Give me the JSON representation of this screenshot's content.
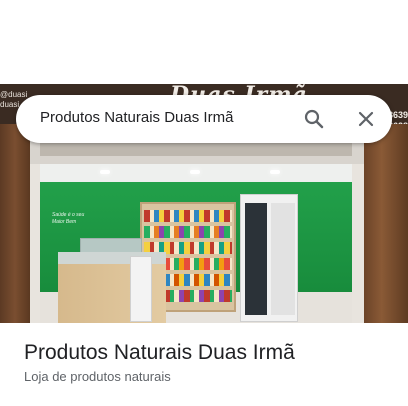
{
  "search": {
    "query": "Produtos Naturais Duas Irmã"
  },
  "photo": {
    "sign_text": "Duas Irmã",
    "left_handle_line1": "@duasi",
    "left_handle_line2": "duasi",
    "right_phone_line1": "3639",
    "right_phone_line2": "8628",
    "wall_text": "Saúde é o seu Maior Bem"
  },
  "place": {
    "title": "Produtos Naturais Duas Irmã",
    "category": "Loja de produtos naturais"
  },
  "colors": {
    "store_green": "#1f7a3c",
    "text_primary": "#202124",
    "text_secondary": "#5f6368"
  },
  "icons": {
    "search": "search-icon",
    "close": "close-icon"
  }
}
